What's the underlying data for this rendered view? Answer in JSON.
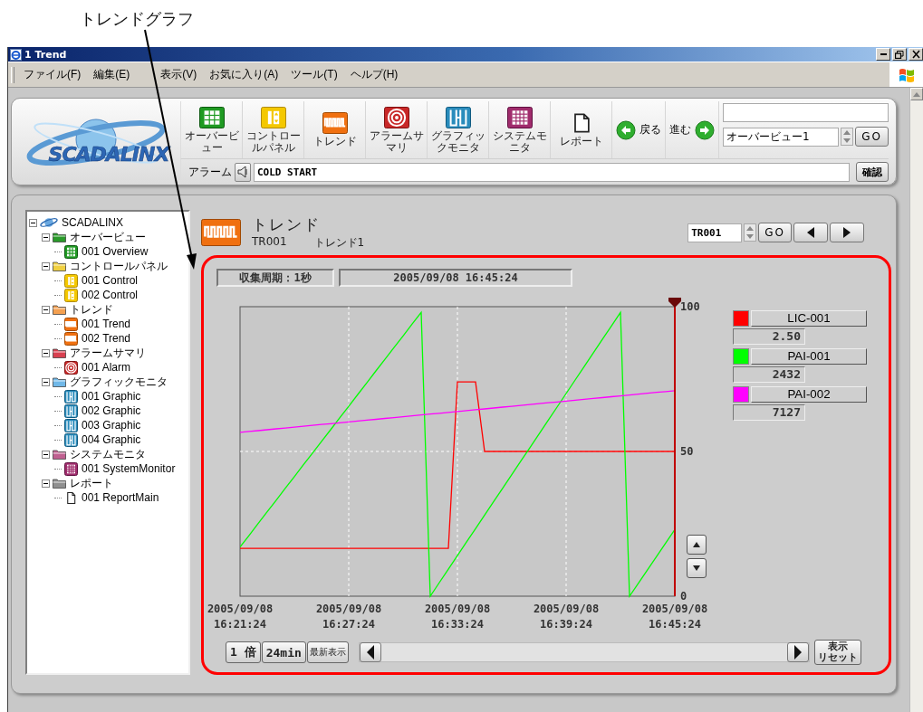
{
  "annotation": {
    "label": "トレンドグラフ"
  },
  "window": {
    "title": "1 Trend"
  },
  "menu": [
    {
      "label": "ファイル(F)"
    },
    {
      "label": "編集(E)"
    },
    {
      "label": "表示(V)"
    },
    {
      "label": "お気に入り(A)"
    },
    {
      "label": "ツール(T)"
    },
    {
      "label": "ヘルプ(H)"
    }
  ],
  "logo": {
    "text": "SCADALINX"
  },
  "toolbar": {
    "buttons": [
      {
        "kind": "overview",
        "label": "オーバービュー"
      },
      {
        "kind": "control",
        "label": "コントロールパネル"
      },
      {
        "kind": "trend",
        "label": "トレンド"
      },
      {
        "kind": "alarm",
        "label": "アラームサマリ"
      },
      {
        "kind": "graphic",
        "label": "グラフィックモニタ"
      },
      {
        "kind": "system",
        "label": "システムモニタ"
      },
      {
        "kind": "report",
        "label": "レポート"
      }
    ],
    "back": "戻る",
    "forward": "進む",
    "screen_select": {
      "value": "オーバービュー1"
    },
    "go": "GO"
  },
  "alarm": {
    "label": "アラーム",
    "message": "COLD START",
    "confirm": "確認"
  },
  "tree": {
    "label": "SCADALINX",
    "kind": "root",
    "expanded": true,
    "children": [
      {
        "label": "オーバービュー",
        "kind": "overview",
        "expanded": true,
        "children": [
          {
            "label": "001 Overview",
            "kind": "overview"
          }
        ]
      },
      {
        "label": "コントロールパネル",
        "kind": "control",
        "expanded": true,
        "children": [
          {
            "label": "001 Control",
            "kind": "control"
          },
          {
            "label": "002 Control",
            "kind": "control"
          }
        ]
      },
      {
        "label": "トレンド",
        "kind": "trend",
        "expanded": true,
        "children": [
          {
            "label": "001 Trend",
            "kind": "trend"
          },
          {
            "label": "002 Trend",
            "kind": "trend"
          }
        ]
      },
      {
        "label": "アラームサマリ",
        "kind": "alarm",
        "expanded": true,
        "children": [
          {
            "label": "001 Alarm",
            "kind": "alarm"
          }
        ]
      },
      {
        "label": "グラフィックモニタ",
        "kind": "graphic",
        "expanded": true,
        "children": [
          {
            "label": "001 Graphic",
            "kind": "graphic"
          },
          {
            "label": "002 Graphic",
            "kind": "graphic"
          },
          {
            "label": "003 Graphic",
            "kind": "graphic"
          },
          {
            "label": "004 Graphic",
            "kind": "graphic"
          }
        ]
      },
      {
        "label": "システムモニタ",
        "kind": "system",
        "expanded": true,
        "children": [
          {
            "label": "001 SystemMonitor",
            "kind": "system"
          }
        ]
      },
      {
        "label": "レポート",
        "kind": "report",
        "expanded": true,
        "children": [
          {
            "label": "001 ReportMain",
            "kind": "report"
          }
        ]
      }
    ]
  },
  "trend": {
    "kind": "trend",
    "title": "トレンド",
    "id": "TR001",
    "name": "トレンド1",
    "selector": {
      "value": "TR001"
    },
    "go": "GO",
    "period": "収集周期：1秒",
    "timestamp": "2005/09/08 16:45:24",
    "chart_data": {
      "type": "line",
      "grid": true,
      "categories": [
        "2005/09/08 16:21:24",
        null,
        null,
        null,
        null,
        null,
        null,
        null,
        null,
        null,
        null,
        null,
        "2005/09/08 16:27:24",
        null,
        null,
        null,
        null,
        null,
        null,
        null,
        null,
        null,
        null,
        null,
        "2005/09/08 16:33:24",
        null,
        null,
        null,
        null,
        null,
        null,
        null,
        null,
        null,
        null,
        null,
        "2005/09/08 16:39:24",
        null,
        null,
        null,
        null,
        null,
        null,
        null,
        null,
        null,
        null,
        null,
        "2005/09/08 16:45:24"
      ],
      "ylim": [
        0,
        100
      ],
      "yticks": [
        0,
        50,
        100
      ],
      "series": [
        {
          "name": "LIC-001",
          "color": "#ff0000",
          "values": [
            16.5,
            16.5,
            16.5,
            16.5,
            16.5,
            16.5,
            16.5,
            16.5,
            16.5,
            16.5,
            16.5,
            16.5,
            16.5,
            16.5,
            16.5,
            16.5,
            16.5,
            16.5,
            16.5,
            16.5,
            16.5,
            16.5,
            16.5,
            16.5,
            74,
            74,
            74,
            50,
            50,
            50,
            50,
            50,
            50,
            50,
            50,
            50,
            50,
            50,
            50,
            50,
            50,
            50,
            50,
            50,
            50,
            50,
            50,
            50,
            50
          ]
        },
        {
          "name": "PAI-001",
          "color": "#00ff00",
          "values": [
            17,
            21,
            25.1,
            29.2,
            33.2,
            37.3,
            41.3,
            45.4,
            49.4,
            53.5,
            57.5,
            61.6,
            65.6,
            69.7,
            73.7,
            77.8,
            81.8,
            85.9,
            89.9,
            94,
            98,
            0,
            4.7,
            9.3,
            14,
            18.7,
            23.3,
            28,
            32.7,
            37.3,
            42,
            46.7,
            51.3,
            56,
            60.7,
            65.3,
            70,
            74.7,
            79.3,
            84,
            88.7,
            93.3,
            98,
            0,
            4.6,
            9.2,
            13.8,
            18.4,
            23
          ]
        },
        {
          "name": "PAI-002",
          "color": "#ff00ff",
          "values": [
            56.6,
            56.9,
            57.2,
            57.5,
            57.8,
            58.1,
            58.4,
            58.7,
            59,
            59.3,
            59.6,
            59.9,
            60.2,
            60.5,
            60.8,
            61.1,
            61.4,
            61.7,
            62,
            62.3,
            62.6,
            62.9,
            63.2,
            63.5,
            63.8,
            64.1,
            64.4,
            64.7,
            65,
            65.3,
            65.6,
            65.9,
            66.2,
            66.5,
            66.8,
            67.1,
            67.4,
            67.7,
            68,
            68.3,
            68.6,
            68.9,
            69.2,
            69.5,
            69.8,
            70.1,
            70.4,
            70.7,
            71
          ]
        }
      ]
    },
    "legend": [
      {
        "value": "2.50"
      },
      {
        "value": "2432"
      },
      {
        "value": "7127"
      }
    ],
    "controls": {
      "zoom": "1 倍",
      "span": "24min",
      "latest": "最新表示",
      "reset_lines": [
        "表示",
        "リセット"
      ]
    }
  }
}
